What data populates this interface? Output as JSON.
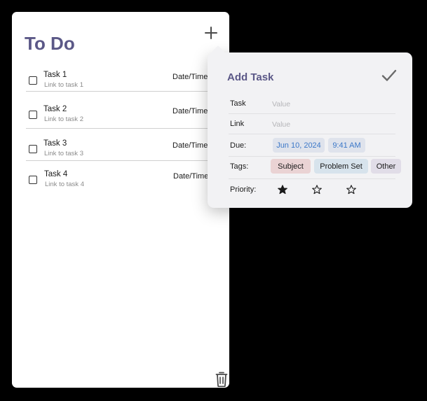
{
  "todo": {
    "title": "To Do",
    "tasks": [
      {
        "name": "Task 1",
        "link": "Link to task 1",
        "datetime": "Date/Time"
      },
      {
        "name": "Task 2",
        "link": "Link to task 2",
        "datetime": "Date/Time"
      },
      {
        "name": "Task 3",
        "link": "Link to task 3",
        "datetime": "Date/Time"
      },
      {
        "name": "Task 4",
        "link": "Link to task 4",
        "datetime": "Date/Time"
      }
    ]
  },
  "add_task": {
    "title": "Add Task",
    "task_label": "Task",
    "task_placeholder": "Value",
    "link_label": "Link",
    "link_placeholder": "Value",
    "due_label": "Due:",
    "due_date": "Jun 10, 2024",
    "due_time": "9:41 AM",
    "tags_label": "Tags:",
    "tags": [
      "Subject",
      "Problem Set",
      "Other"
    ],
    "priority_label": "Priority:",
    "priority": {
      "filled": 1,
      "total": 3
    }
  },
  "colors": {
    "title": "#5b5887",
    "tag_subject": "#ead3d4",
    "tag_problem_set": "#d7e3ec",
    "tag_other": "#e1dde8",
    "date_chip": "#dfe3ec",
    "date_text": "#3c78c8"
  },
  "icons": {
    "add": "plus-icon",
    "confirm": "checkmark-icon",
    "delete": "trash-icon",
    "priority": "star-icon"
  }
}
